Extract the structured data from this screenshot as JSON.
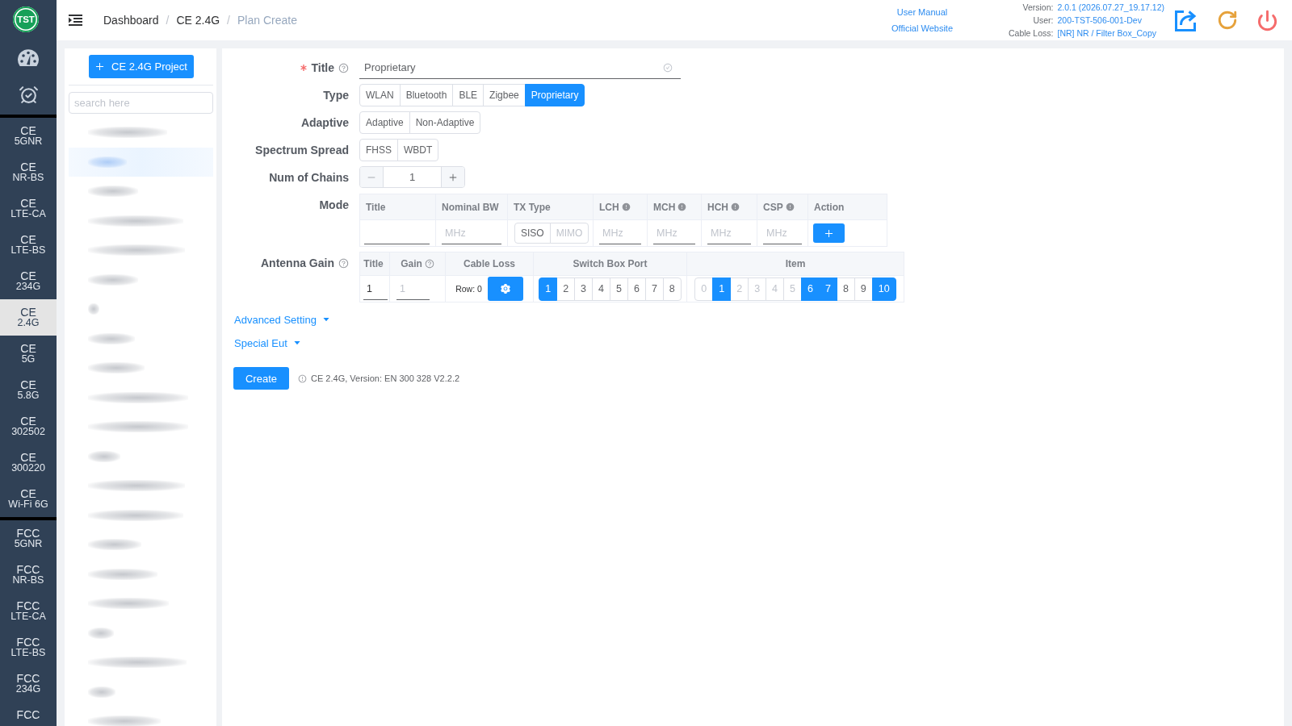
{
  "nav_rail": {
    "logo": "TST",
    "groups": [
      {
        "items": [
          {
            "line1": "CE",
            "line2": "5GNR",
            "selected": false
          },
          {
            "line1": "CE",
            "line2": "NR-BS",
            "selected": false
          },
          {
            "line1": "CE",
            "line2": "LTE-CA",
            "selected": false
          },
          {
            "line1": "CE",
            "line2": "LTE-BS",
            "selected": false
          },
          {
            "line1": "CE",
            "line2": "234G",
            "selected": false
          },
          {
            "line1": "CE",
            "line2": "2.4G",
            "selected": true
          },
          {
            "line1": "CE",
            "line2": "5G",
            "selected": false
          },
          {
            "line1": "CE",
            "line2": "5.8G",
            "selected": false
          },
          {
            "line1": "CE",
            "line2": "302502",
            "selected": false
          },
          {
            "line1": "CE",
            "line2": "300220",
            "selected": false
          },
          {
            "line1": "CE",
            "line2": "Wi-Fi 6G",
            "selected": false
          }
        ]
      },
      {
        "items": [
          {
            "line1": "FCC",
            "line2": "5GNR",
            "selected": false
          },
          {
            "line1": "FCC",
            "line2": "NR-BS",
            "selected": false
          },
          {
            "line1": "FCC",
            "line2": "LTE-CA",
            "selected": false
          },
          {
            "line1": "FCC",
            "line2": "LTE-BS",
            "selected": false
          },
          {
            "line1": "FCC",
            "line2": "234G",
            "selected": false
          },
          {
            "line1": "FCC",
            "selected": false
          }
        ]
      }
    ]
  },
  "header": {
    "breadcrumb": [
      {
        "label": "Dashboard",
        "separator": "/"
      },
      {
        "label": "CE 2.4G",
        "separator": "/"
      },
      {
        "label": "Plan Create"
      }
    ],
    "links": [
      "User Manual",
      "Official Website"
    ],
    "info": [
      {
        "label": "Version:",
        "value": "2.0.1 (2026.07.27_19.17.12)"
      },
      {
        "label": "User:",
        "value": "200-TST-506-001-Dev"
      },
      {
        "label": "Cable Loss:",
        "value": "[NR] NR / Filter Box_Copy"
      }
    ]
  },
  "project_panel": {
    "new_button": "CE 2.4G Project",
    "search": {
      "placeholder": "search here"
    },
    "items": [
      {
        "selected": false
      },
      {
        "selected": true
      },
      {
        "selected": false
      },
      {
        "selected": false
      },
      {
        "selected": false
      },
      {
        "selected": false
      },
      {
        "selected": false
      },
      {
        "selected": false
      },
      {
        "selected": false
      },
      {
        "selected": false
      },
      {
        "selected": false
      },
      {
        "selected": false
      },
      {
        "selected": false
      },
      {
        "selected": false
      },
      {
        "selected": false
      },
      {
        "selected": false
      },
      {
        "selected": false
      },
      {
        "selected": false
      },
      {
        "selected": false
      },
      {
        "selected": false
      },
      {
        "selected": false
      }
    ]
  },
  "form": {
    "title": {
      "label": "Title",
      "required": true,
      "help": true,
      "value": "Proprietary"
    },
    "type": {
      "label": "Type",
      "options": [
        {
          "label": "WLAN",
          "selected": false
        },
        {
          "label": "Bluetooth",
          "selected": false
        },
        {
          "label": "BLE",
          "selected": false
        },
        {
          "label": "Zigbee",
          "selected": false
        },
        {
          "label": "Proprietary",
          "selected": true
        }
      ]
    },
    "adaptive": {
      "label": "Adaptive",
      "options": [
        {
          "label": "Adaptive",
          "selected": false
        },
        {
          "label": "Non-Adaptive",
          "selected": false
        }
      ]
    },
    "spectrum_spread": {
      "label": "Spectrum Spread",
      "options": [
        {
          "label": "FHSS",
          "selected": false
        },
        {
          "label": "WBDT",
          "selected": false
        }
      ]
    },
    "num_of_chains": {
      "label": "Num of Chains",
      "value": "1"
    },
    "mode": {
      "label": "Mode",
      "columns": [
        {
          "label": "Title",
          "info": false
        },
        {
          "label": "Nominal BW",
          "info": false
        },
        {
          "label": "TX Type",
          "info": false
        },
        {
          "label": "LCH",
          "info": true
        },
        {
          "label": "MCH",
          "info": true
        },
        {
          "label": "HCH",
          "info": true
        },
        {
          "label": "CSP",
          "info": true
        },
        {
          "label": "Action",
          "info": false
        }
      ],
      "row": [
        {
          "kind": "input"
        },
        {
          "kind": "input",
          "placeholder": "MHz"
        },
        {
          "kind": "toggle",
          "options": [
            {
              "label": "SISO",
              "selected": false,
              "disabled": false
            },
            {
              "label": "MIMO",
              "selected": false,
              "disabled": true
            }
          ]
        },
        {
          "kind": "input",
          "placeholder": "MHz"
        },
        {
          "kind": "input",
          "placeholder": "MHz"
        },
        {
          "kind": "input",
          "placeholder": "MHz"
        },
        {
          "kind": "input",
          "placeholder": "MHz"
        },
        {
          "kind": "add"
        }
      ]
    },
    "antenna_gain": {
      "label": "Antenna Gain",
      "help": true,
      "columns": [
        {
          "label": "Title",
          "help": false
        },
        {
          "label": "Gain",
          "help": true
        },
        {
          "label": "Cable Loss",
          "help": false
        },
        {
          "label": "Switch Box Port",
          "help": false
        },
        {
          "label": "Item",
          "help": false
        }
      ],
      "row": {
        "title_value": "1",
        "gain_placeholder": "1",
        "cable_loss_label": "Row: 0",
        "switch_ports": [
          {
            "label": "1",
            "selected": true
          },
          {
            "label": "2",
            "selected": false
          },
          {
            "label": "3",
            "selected": false
          },
          {
            "label": "4",
            "selected": false
          },
          {
            "label": "5",
            "selected": false
          },
          {
            "label": "6",
            "selected": false
          },
          {
            "label": "7",
            "selected": false
          },
          {
            "label": "8",
            "selected": false
          }
        ],
        "items": [
          {
            "label": "0",
            "selected": false,
            "disabled": true
          },
          {
            "label": "1",
            "selected": true,
            "disabled": false
          },
          {
            "label": "2",
            "selected": false,
            "disabled": true
          },
          {
            "label": "3",
            "selected": false,
            "disabled": true
          },
          {
            "label": "4",
            "selected": false,
            "disabled": true
          },
          {
            "label": "5",
            "selected": false,
            "disabled": true
          },
          {
            "label": "6",
            "selected": true,
            "disabled": false
          },
          {
            "label": "7",
            "selected": true,
            "disabled": false
          },
          {
            "label": "8",
            "selected": false,
            "disabled": false
          },
          {
            "label": "9",
            "selected": false,
            "disabled": false
          },
          {
            "label": "10",
            "selected": true,
            "disabled": false
          }
        ]
      }
    },
    "advanced_setting": "Advanced Setting",
    "special_eut": "Special Eut",
    "create_button": "Create",
    "version_note": "CE 2.4G, Version: EN 300 328 V2.2.2"
  }
}
